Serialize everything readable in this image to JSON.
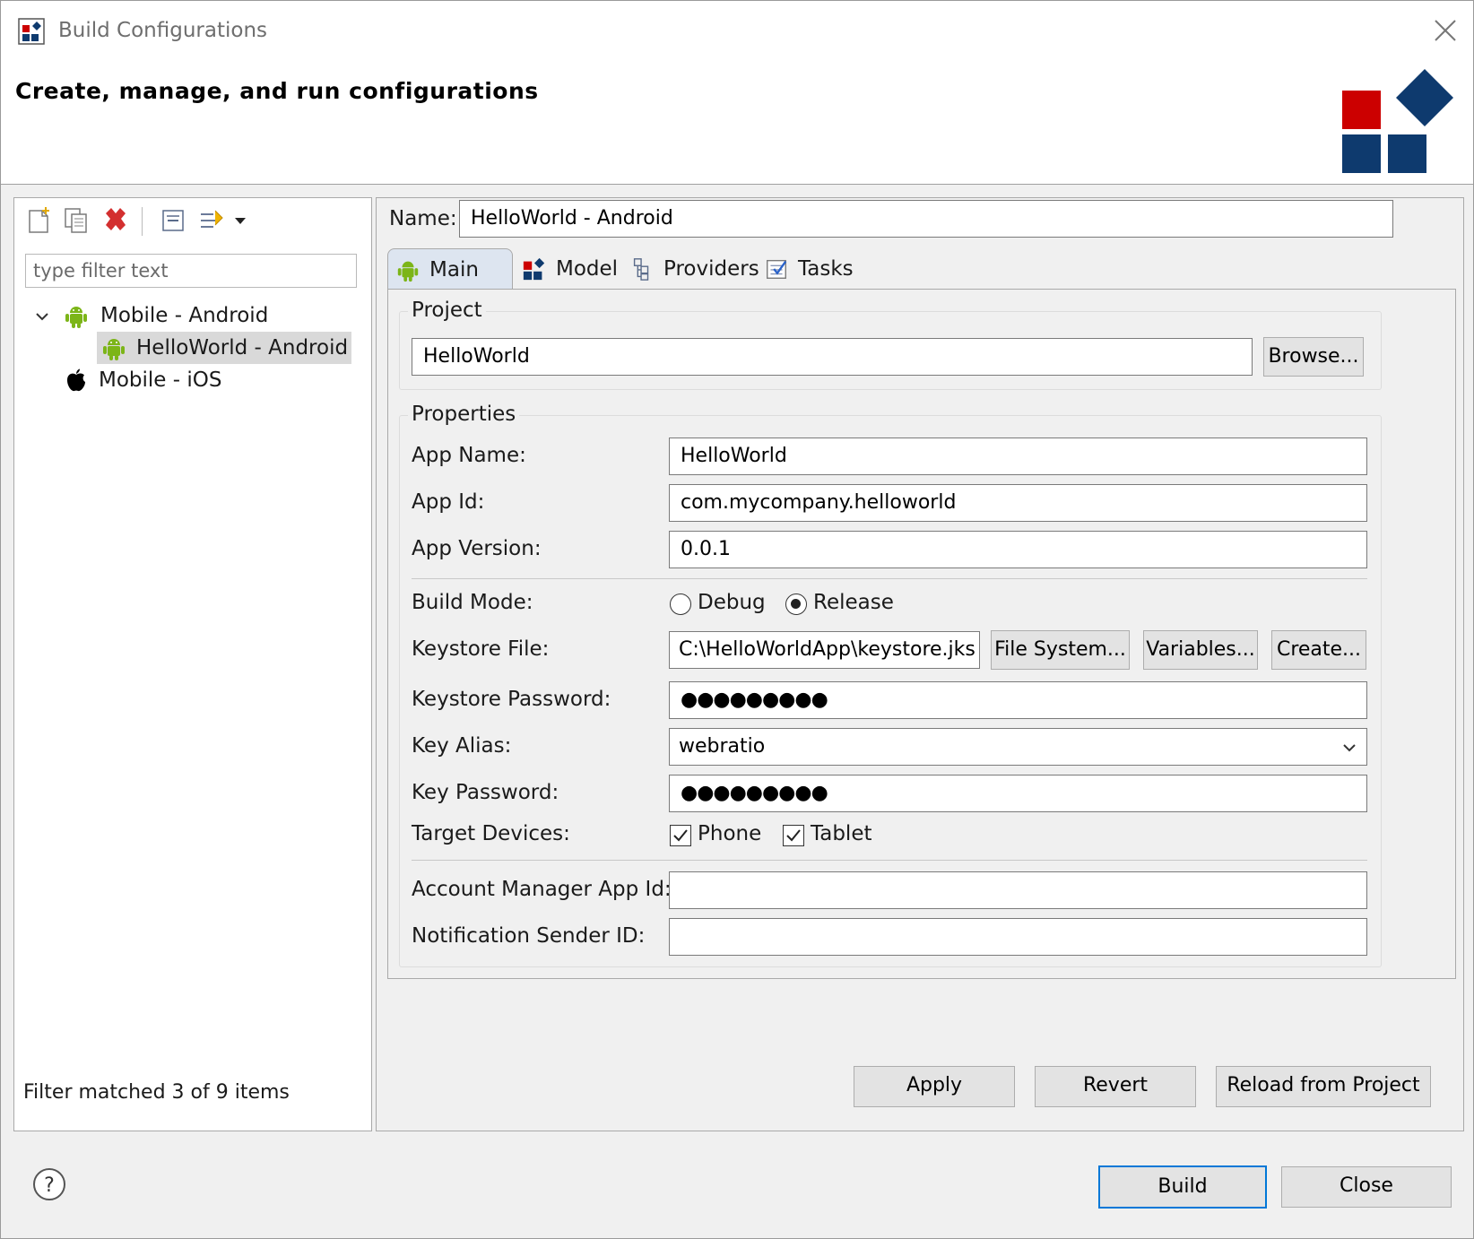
{
  "window": {
    "title": "Build Configurations",
    "close_icon": "close-icon"
  },
  "header": {
    "title": "Create, manage, and run configurations",
    "logo": "webratio-logo"
  },
  "sidebar": {
    "toolbar": [
      "new-config-icon",
      "duplicate-icon",
      "delete-icon",
      "collapse-all-icon",
      "filter-icon",
      "dropdown-arrow-icon"
    ],
    "filter_placeholder": "type filter text",
    "tree": [
      {
        "label": "Mobile - Android",
        "expanded": true,
        "icon": "android-icon"
      },
      {
        "label": "HelloWorld - Android",
        "selected": true,
        "icon": "android-icon"
      },
      {
        "label": "Mobile - iOS",
        "icon": "apple-icon"
      }
    ],
    "status": "Filter matched 3 of 9 items"
  },
  "main": {
    "name_label": "Name:",
    "name_value": "HelloWorld - Android",
    "tabs": [
      {
        "label": "Main",
        "active": true
      },
      {
        "label": "Model"
      },
      {
        "label": "Providers"
      },
      {
        "label": "Tasks"
      }
    ],
    "project": {
      "group_title": "Project",
      "value": "HelloWorld",
      "browse_label": "Browse..."
    },
    "properties": {
      "group_title": "Properties",
      "app_name_label": "App Name:",
      "app_name_value": "HelloWorld",
      "app_id_label": "App Id:",
      "app_id_value": "com.mycompany.helloworld",
      "app_version_label": "App Version:",
      "app_version_value": "0.0.1",
      "build_mode_label": "Build Mode:",
      "build_mode_options": [
        "Debug",
        "Release"
      ],
      "build_mode_selected": "Release",
      "keystore_file_label": "Keystore File:",
      "keystore_file_value": "C:\\HelloWorldApp\\keystore.jks",
      "file_system_label": "File System...",
      "variables_label": "Variables...",
      "create_label": "Create...",
      "keystore_password_label": "Keystore Password:",
      "keystore_password_value": "●●●●●●●●●",
      "key_alias_label": "Key Alias:",
      "key_alias_value": "webratio",
      "key_password_label": "Key Password:",
      "key_password_value": "●●●●●●●●●",
      "target_devices_label": "Target Devices:",
      "target_phone": "Phone",
      "target_tablet": "Tablet",
      "phone_checked": true,
      "tablet_checked": true,
      "account_manager_label": "Account Manager App Id:",
      "account_manager_value": "",
      "notification_sender_label": "Notification Sender ID:",
      "notification_sender_value": ""
    },
    "apply_label": "Apply",
    "revert_label": "Revert",
    "reload_label": "Reload from Project"
  },
  "footer": {
    "help_icon": "help-icon",
    "build_label": "Build",
    "close_label": "Close"
  },
  "colors": {
    "accent_blue": "#0078d7",
    "logo_red": "#cc0000",
    "logo_navy": "#0e3a6e",
    "android_green": "#7cb518"
  }
}
